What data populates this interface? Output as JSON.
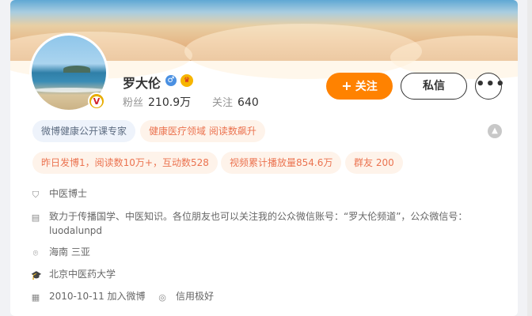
{
  "profile": {
    "name": "罗大伦",
    "gender_icon": "male-icon",
    "member_icon": "vip-crown-icon",
    "verified_icon": "v-verified-icon",
    "fans_label": "粉丝",
    "fans_value": "210.9万",
    "following_label": "关注",
    "following_value": "640"
  },
  "actions": {
    "follow_label": "关注",
    "follow_icon": "+",
    "message_label": "私信",
    "more_icon": "•••"
  },
  "tags_row1": [
    {
      "label": "微博健康公开课专家"
    },
    {
      "label": "健康医疗领域 阅读数飙升"
    }
  ],
  "tags_row2": [
    {
      "label": "昨日发博1，阅读数10万+，互动数528"
    },
    {
      "label": "视频累计播放量854.6万"
    },
    {
      "label": "群友 200"
    }
  ],
  "details": {
    "title": "中医博士",
    "bio": "致力于传播国学、中医知识。各位朋友也可以关注我的公众微信账号：“罗大伦频道”，公众微信号：luodalunpd",
    "location": "海南 三亚",
    "school": "北京中医药大学",
    "joined": "2010-10-11 加入微博",
    "credit": "信用极好"
  },
  "colors": {
    "accent": "#ff8200",
    "tag_orange_text": "#eb7350",
    "tag_blue_text": "#5e6d82"
  }
}
